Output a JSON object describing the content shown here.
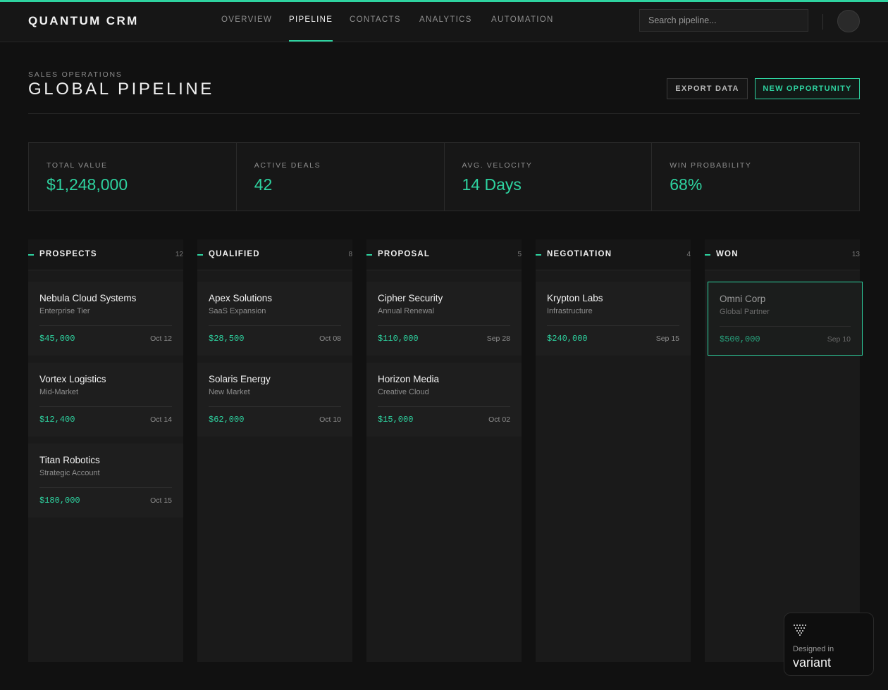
{
  "app": {
    "brand": "QUANTUM CRM"
  },
  "nav": {
    "tabs": [
      {
        "label": "OVERVIEW",
        "active": false
      },
      {
        "label": "PIPELINE",
        "active": true
      },
      {
        "label": "CONTACTS",
        "active": false
      },
      {
        "label": "ANALYTICS",
        "active": false
      },
      {
        "label": "AUTOMATION",
        "active": false
      }
    ]
  },
  "search": {
    "placeholder": "Search pipeline...",
    "value": ""
  },
  "page": {
    "eyebrow": "SALES OPERATIONS",
    "title": "GLOBAL PIPELINE",
    "export_label": "EXPORT DATA",
    "new_label": "NEW OPPORTUNITY"
  },
  "stats": [
    {
      "label": "TOTAL VALUE",
      "value": "$1,248,000"
    },
    {
      "label": "ACTIVE DEALS",
      "value": "42"
    },
    {
      "label": "AVG. VELOCITY",
      "value": "14 Days"
    },
    {
      "label": "WIN PROBABILITY",
      "value": "68%"
    }
  ],
  "columns": [
    {
      "title": "PROSPECTS",
      "count": "12",
      "cards": [
        {
          "name": "Nebula Cloud Systems",
          "sub": "Enterprise Tier",
          "amount": "$45,000",
          "date": "Oct 12"
        },
        {
          "name": "Vortex Logistics",
          "sub": "Mid-Market",
          "amount": "$12,400",
          "date": "Oct 14"
        },
        {
          "name": "Titan Robotics",
          "sub": "Strategic Account",
          "amount": "$180,000",
          "date": "Oct 15"
        }
      ]
    },
    {
      "title": "QUALIFIED",
      "count": "8",
      "cards": [
        {
          "name": "Apex Solutions",
          "sub": "SaaS Expansion",
          "amount": "$28,500",
          "date": "Oct 08"
        },
        {
          "name": "Solaris Energy",
          "sub": "New Market",
          "amount": "$62,000",
          "date": "Oct 10"
        }
      ]
    },
    {
      "title": "PROPOSAL",
      "count": "5",
      "cards": [
        {
          "name": "Cipher Security",
          "sub": "Annual Renewal",
          "amount": "$110,000",
          "date": "Sep 28"
        },
        {
          "name": "Horizon Media",
          "sub": "Creative Cloud",
          "amount": "$15,000",
          "date": "Oct 02"
        }
      ]
    },
    {
      "title": "NEGOTIATION",
      "count": "4",
      "cards": [
        {
          "name": "Krypton Labs",
          "sub": "Infrastructure",
          "amount": "$240,000",
          "date": "Sep 15"
        }
      ]
    },
    {
      "title": "WON",
      "count": "13",
      "cards": [
        {
          "name": "Omni Corp",
          "sub": "Global Partner",
          "amount": "$500,000",
          "date": "Sep 10",
          "highlight": true
        }
      ]
    }
  ],
  "badge": {
    "small": "Designed in",
    "big": "variant"
  },
  "colors": {
    "accent": "#2ed3a0",
    "background": "#111111"
  }
}
